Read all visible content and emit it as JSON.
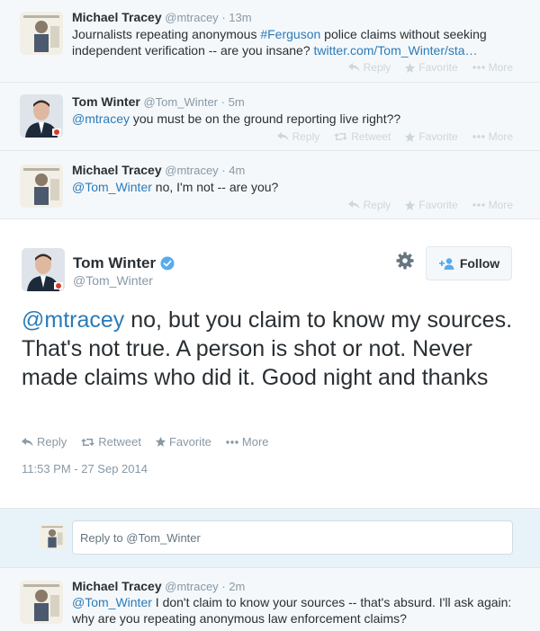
{
  "colors": {
    "link": "#2b7bb9",
    "verified": "#55acee",
    "muted": "#8899a6",
    "bg_context": "#f5f8fa",
    "reply_bg": "#e8f3f9"
  },
  "tweet1": {
    "fullname": "Michael Tracey",
    "username": "@mtracey",
    "dot": "·",
    "time": "13m",
    "text_pre": "Journalists repeating anonymous ",
    "hashtag": "#Ferguson",
    "text_mid": " police claims without seeking independent verification -- are you insane? ",
    "url": "twitter.com/Tom_Winter/sta…",
    "actions": {
      "reply": "Reply",
      "favorite": "Favorite",
      "more": "More"
    }
  },
  "tweet2": {
    "fullname": "Tom Winter",
    "username": "@Tom_Winter",
    "dot": "·",
    "time": "5m",
    "mention": "@mtracey",
    "text": " you must be on the ground reporting live right??",
    "actions": {
      "reply": "Reply",
      "retweet": "Retweet",
      "favorite": "Favorite",
      "more": "More"
    }
  },
  "tweet3": {
    "fullname": "Michael Tracey",
    "username": "@mtracey",
    "dot": "·",
    "time": "4m",
    "mention": "@Tom_Winter",
    "text": " no, I'm not -- are you?",
    "actions": {
      "reply": "Reply",
      "favorite": "Favorite",
      "more": "More"
    }
  },
  "main": {
    "fullname": "Tom Winter",
    "username": "@Tom_Winter",
    "follow_label": "Follow",
    "mention": "@mtracey",
    "text": " no, but you claim to know my sources. That's not true. A person is shot or not. Never made claims who did it. Good night and thanks",
    "actions": {
      "reply": "Reply",
      "retweet": "Retweet",
      "favorite": "Favorite",
      "more": "More"
    },
    "timestamp": "11:53 PM - 27 Sep 2014"
  },
  "reply_box": {
    "placeholder": "Reply to @Tom_Winter"
  },
  "tweet4": {
    "fullname": "Michael Tracey",
    "username": "@mtracey",
    "dot": "·",
    "time": "2m",
    "mention": "@Tom_Winter",
    "text": " I don't claim to know your sources -- that's absurd. I'll ask again: why are you repeating anonymous law enforcement claims?"
  }
}
